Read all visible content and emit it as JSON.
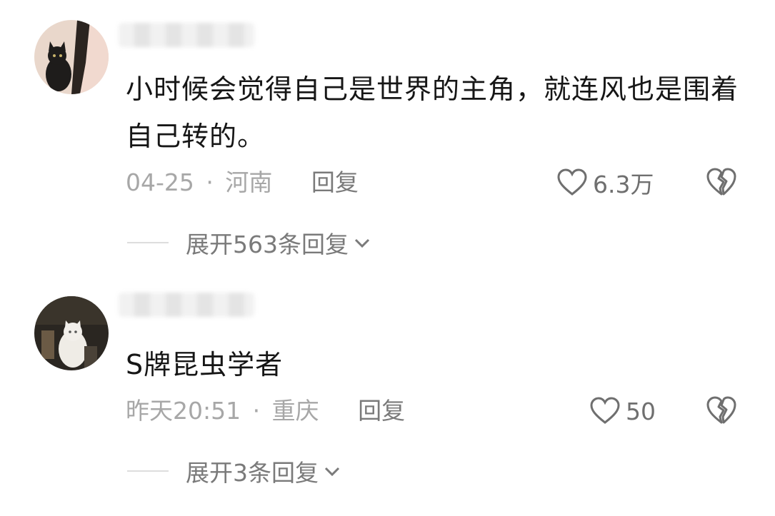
{
  "comments": [
    {
      "avatar_icon": "cat-avatar-icon",
      "content": "小时候会觉得自己是世界的主角，就连风也是围着自己转的。",
      "date": "04-25",
      "separator": "·",
      "location": "河南",
      "reply_label": "回复",
      "like_icon": "heart-icon",
      "likes": "6.3万",
      "dislike_icon": "broken-heart-icon",
      "expand_label": "展开563条回复"
    },
    {
      "avatar_icon": "cat-avatar-icon",
      "content": "S牌昆虫学者",
      "date": "昨天20:51",
      "separator": "·",
      "location": "重庆",
      "reply_label": "回复",
      "like_icon": "heart-icon",
      "likes": "50",
      "dislike_icon": "broken-heart-icon",
      "expand_label": "展开3条回复"
    }
  ],
  "colors": {
    "text": "#161616",
    "meta": "#a7a7a7",
    "action": "#7a7a7a",
    "background": "#ffffff"
  }
}
